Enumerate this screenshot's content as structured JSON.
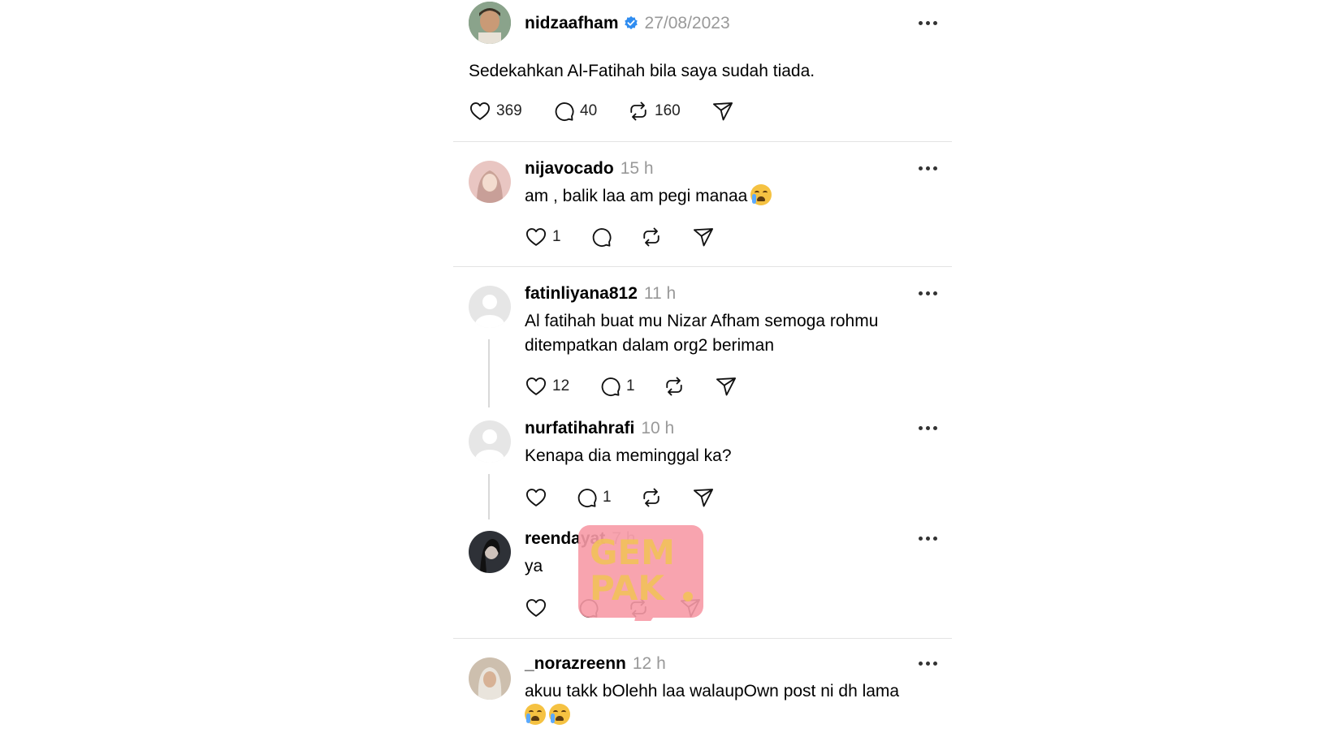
{
  "colors": {
    "verified": "#2f8cf0",
    "watermark": "#f79aa6",
    "muted": "#999999"
  },
  "watermark": {
    "line1": "GEM",
    "line2": "PAK"
  },
  "post": {
    "username": "nidzaafham",
    "date": "27/08/2023",
    "text": "Sedekahkan Al-Fatihah bila saya sudah tiada.",
    "likes": "369",
    "comments": "40",
    "reposts": "160"
  },
  "replies": [
    {
      "username": "nijavocado",
      "time": "15 h",
      "lines": [
        "am , balik laa am pegi manaa"
      ],
      "emoji_count": 1,
      "likes": "1",
      "comments": "",
      "avatar": "photo-pink"
    },
    {
      "username": "fatinliyana812",
      "time": "11 h",
      "lines": [
        "Al fatihah buat mu Nizar Afham semoga rohmu",
        "ditempatkan dalam org2 beriman"
      ],
      "emoji_count": 0,
      "likes": "12",
      "comments": "1",
      "avatar": "default"
    },
    {
      "username": "nurfatihahrafi",
      "time": "10 h",
      "lines": [
        "Kenapa dia meminggal ka?"
      ],
      "emoji_count": 0,
      "likes": "",
      "comments": "1",
      "avatar": "default"
    },
    {
      "username": "reendayat",
      "time": "7 h",
      "lines": [
        "ya"
      ],
      "emoji_count": 0,
      "likes": "",
      "comments": "",
      "avatar": "photo-dark"
    },
    {
      "username": "_norazreenn",
      "time": "12 h",
      "lines": [
        "akuu takk bOlehh laa walaupOwn post ni dh lama"
      ],
      "emoji_count": 2,
      "likes": "",
      "comments": "",
      "avatar": "photo-hijab"
    }
  ]
}
